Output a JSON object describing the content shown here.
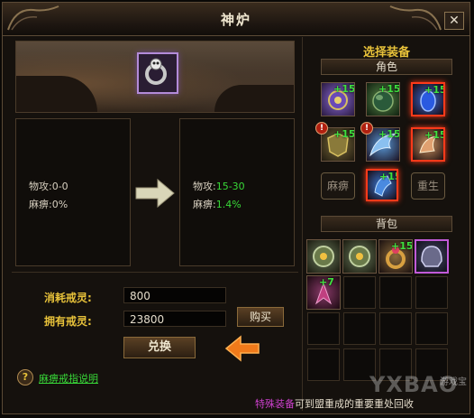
{
  "window": {
    "title": "神炉",
    "close_glyph": "✕"
  },
  "left_panel": {
    "current": {
      "attack": "物攻:0-0",
      "paralyze": "麻痹:0%"
    },
    "upgraded": {
      "attack_label": "物攻:",
      "attack_value": "15-30",
      "paralyze_label": "麻痹:",
      "paralyze_value": "1.4%"
    },
    "cost_label": "消耗戒灵:",
    "cost_value": "800",
    "owned_label": "拥有戒灵:",
    "owned_value": "23800",
    "buy_button": "购买",
    "exchange_button": "兑换",
    "help_icon": "?",
    "help_link": "麻痹戒指说明"
  },
  "right_panel": {
    "title": "选择装备",
    "character_tab": "角色",
    "bag_tab": "背包",
    "character_items": [
      {
        "plus": "+15",
        "icon": "amulet-icon"
      },
      {
        "plus": "+15",
        "icon": "orb-icon"
      },
      {
        "plus": "+15",
        "icon": "gem-icon"
      },
      {
        "plus": "+15",
        "icon": "shield-icon"
      },
      {
        "plus": "+15",
        "icon": "wing-icon"
      },
      {
        "plus": "+15",
        "icon": "claw-icon"
      }
    ],
    "warning_badge": "!",
    "paralyze_slot": "麻痹",
    "center_item_plus": "+15",
    "rebirth_slot": "重生",
    "bag_items": [
      {
        "plus": "",
        "icon": "medallion-icon"
      },
      {
        "plus": "",
        "icon": "medallion-icon"
      },
      {
        "plus": "+15",
        "icon": "ring-icon"
      },
      {
        "plus": "",
        "icon": "helmet-icon"
      },
      {
        "plus": "+7",
        "icon": "wing-icon"
      }
    ]
  },
  "footer": {
    "text_special": "特殊装备",
    "text_rest": "可到盟重成的重要重处回收"
  },
  "watermark": {
    "brand": "YXBAO",
    "sub": "游戏宝"
  }
}
